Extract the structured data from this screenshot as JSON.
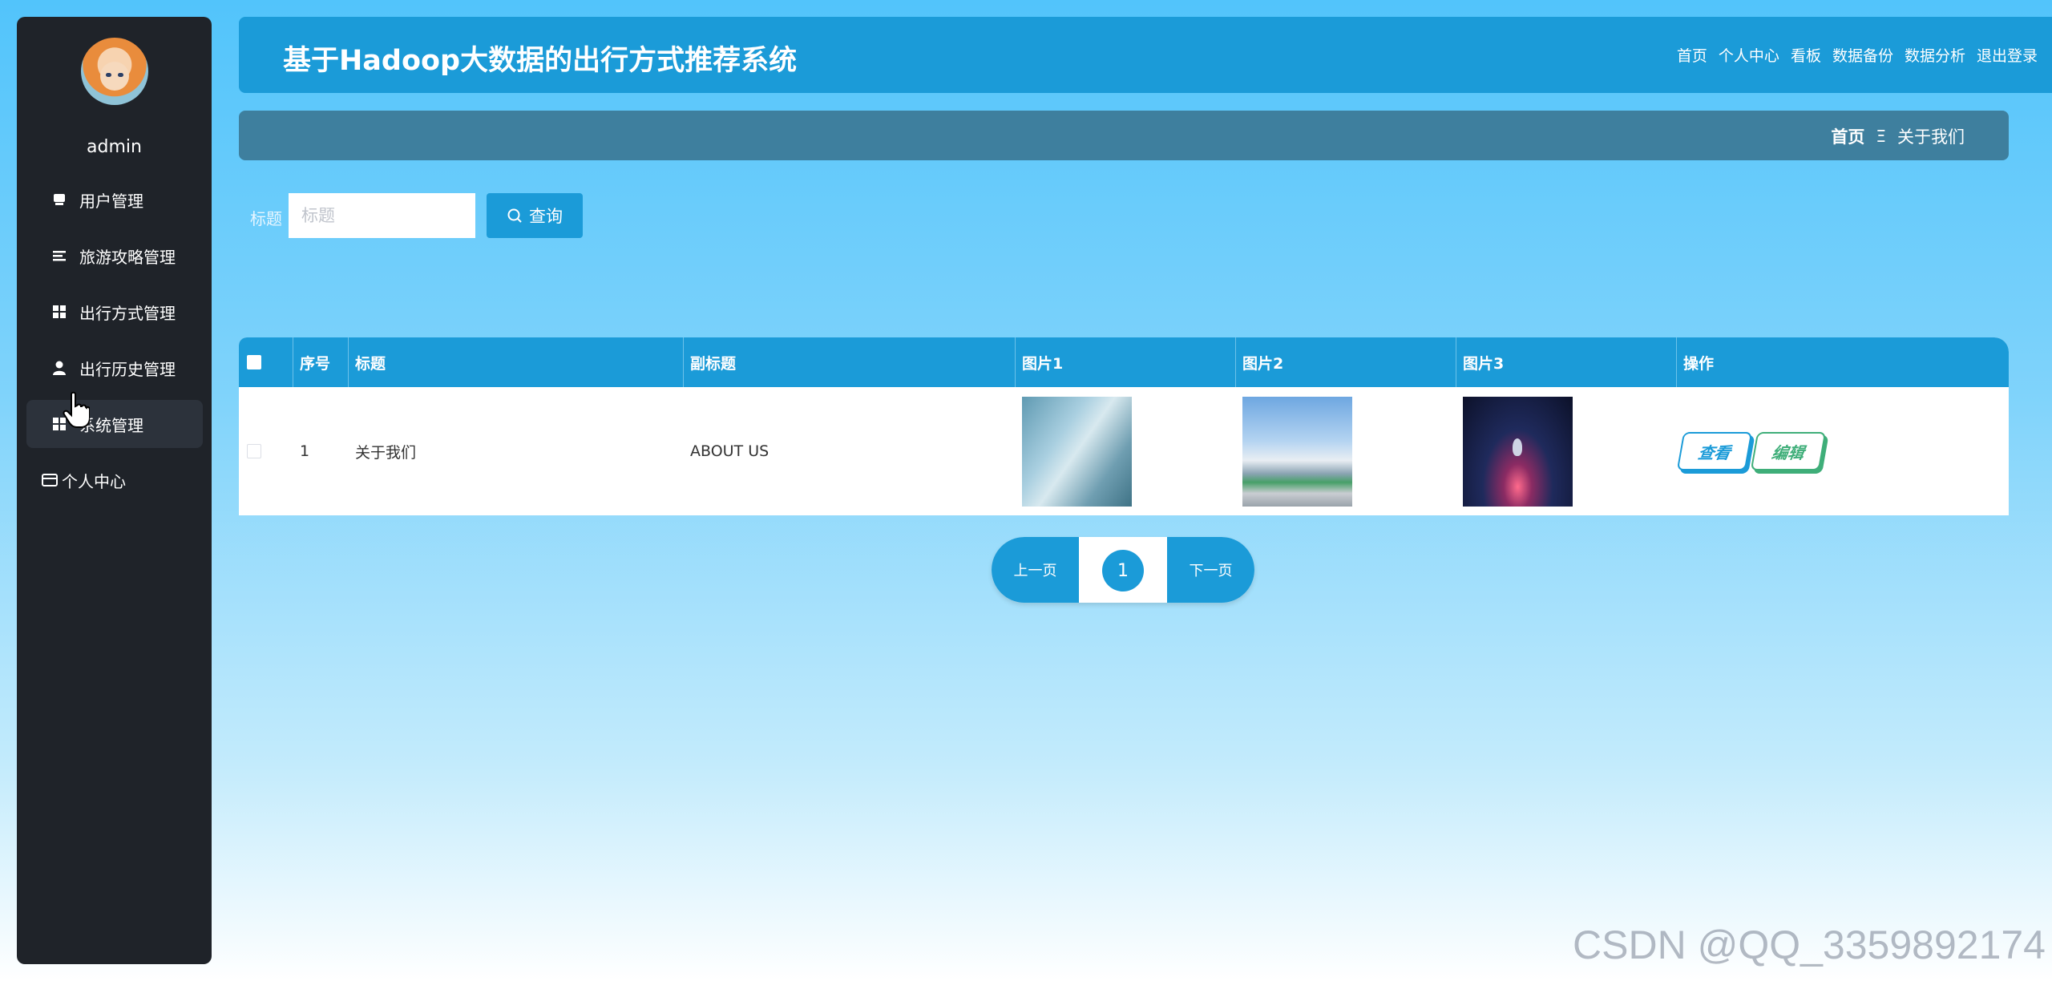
{
  "sidebar": {
    "username": "admin",
    "items": [
      {
        "label": "用户管理",
        "icon": "user-card-icon"
      },
      {
        "label": "旅游攻略管理",
        "icon": "list-icon"
      },
      {
        "label": "出行方式管理",
        "icon": "grid-icon"
      },
      {
        "label": "出行历史管理",
        "icon": "person-icon"
      },
      {
        "label": "系统管理",
        "icon": "grid-icon",
        "active": true
      },
      {
        "label": "个人中心",
        "icon": "wallet-icon"
      }
    ]
  },
  "header": {
    "title": "基于Hadoop大数据的出行方式推荐系统",
    "nav": [
      "首页",
      "个人中心",
      "看板",
      "数据备份",
      "数据分析",
      "退出登录"
    ]
  },
  "breadcrumb": {
    "home": "首页",
    "separator": "Ξ",
    "current": "关于我们"
  },
  "search": {
    "label": "标题",
    "placeholder": "标题",
    "button": "查询"
  },
  "table": {
    "columns": [
      "序号",
      "标题",
      "副标题",
      "图片1",
      "图片2",
      "图片3",
      "操作"
    ],
    "rows": [
      {
        "index": "1",
        "title": "关于我们",
        "subtitle": "ABOUT US",
        "view": "查看",
        "edit": "编辑"
      }
    ]
  },
  "pagination": {
    "prev": "上一页",
    "current": "1",
    "next": "下一页"
  },
  "watermark": "CSDN @QQ_3359892174",
  "colors": {
    "primary": "#1b9bd8",
    "sidebar": "#1f2329",
    "edit": "#3fae79"
  }
}
